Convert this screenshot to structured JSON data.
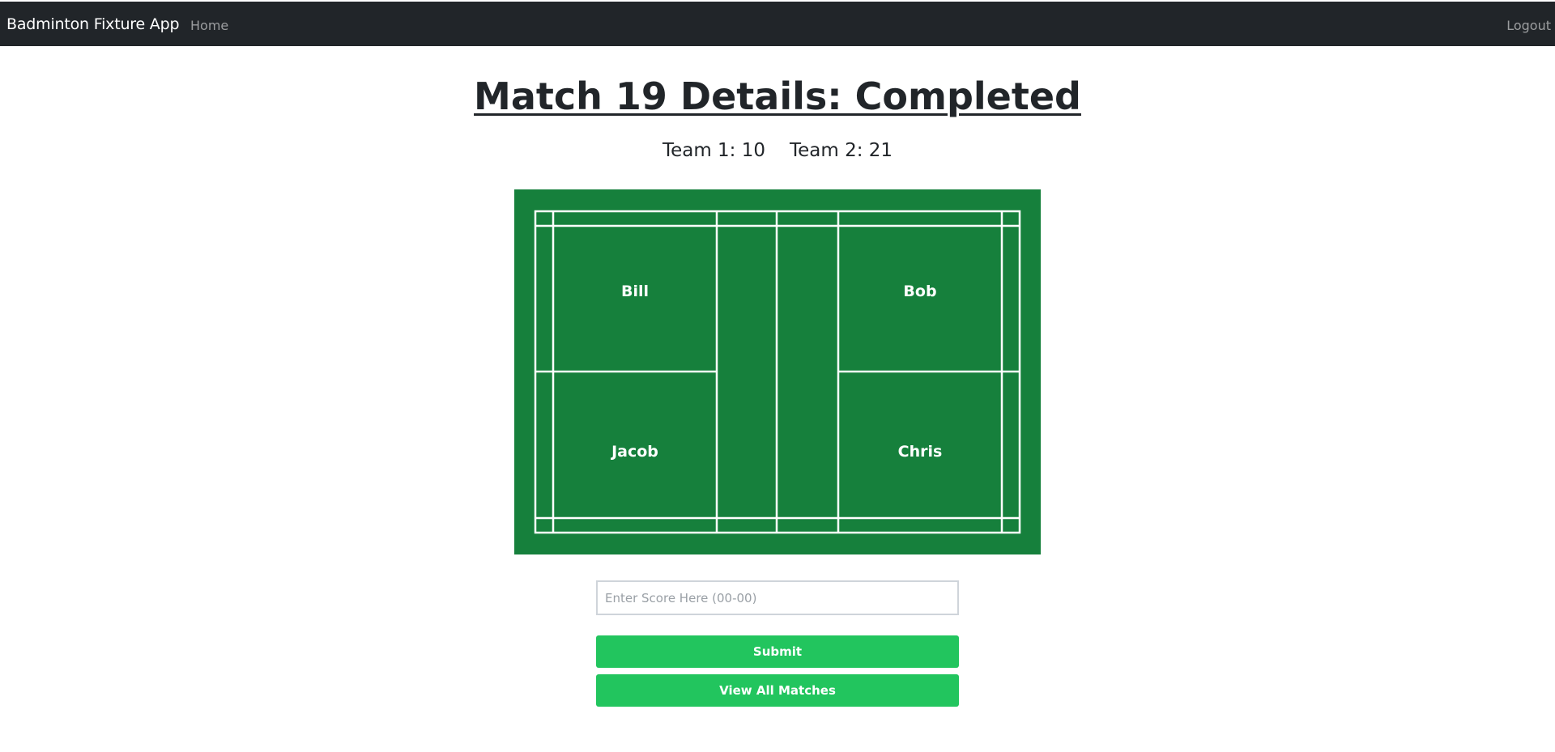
{
  "navbar": {
    "brand": "Badminton Fixture App",
    "home_label": "Home",
    "logout_label": "Logout"
  },
  "match": {
    "title": "Match 19 Details: Completed",
    "team1_score": "Team 1: 10",
    "team2_score": "Team 2: 21"
  },
  "court": {
    "color": "#16803c",
    "line_color": "#ffffff",
    "players": {
      "top_left": "Bill",
      "top_right": "Bob",
      "bottom_left": "Jacob",
      "bottom_right": "Chris"
    }
  },
  "form": {
    "score_placeholder": "Enter Score Here (00-00)",
    "score_value": "",
    "submit_label": "Submit",
    "view_all_label": "View All Matches",
    "button_color": "#22c55e"
  }
}
